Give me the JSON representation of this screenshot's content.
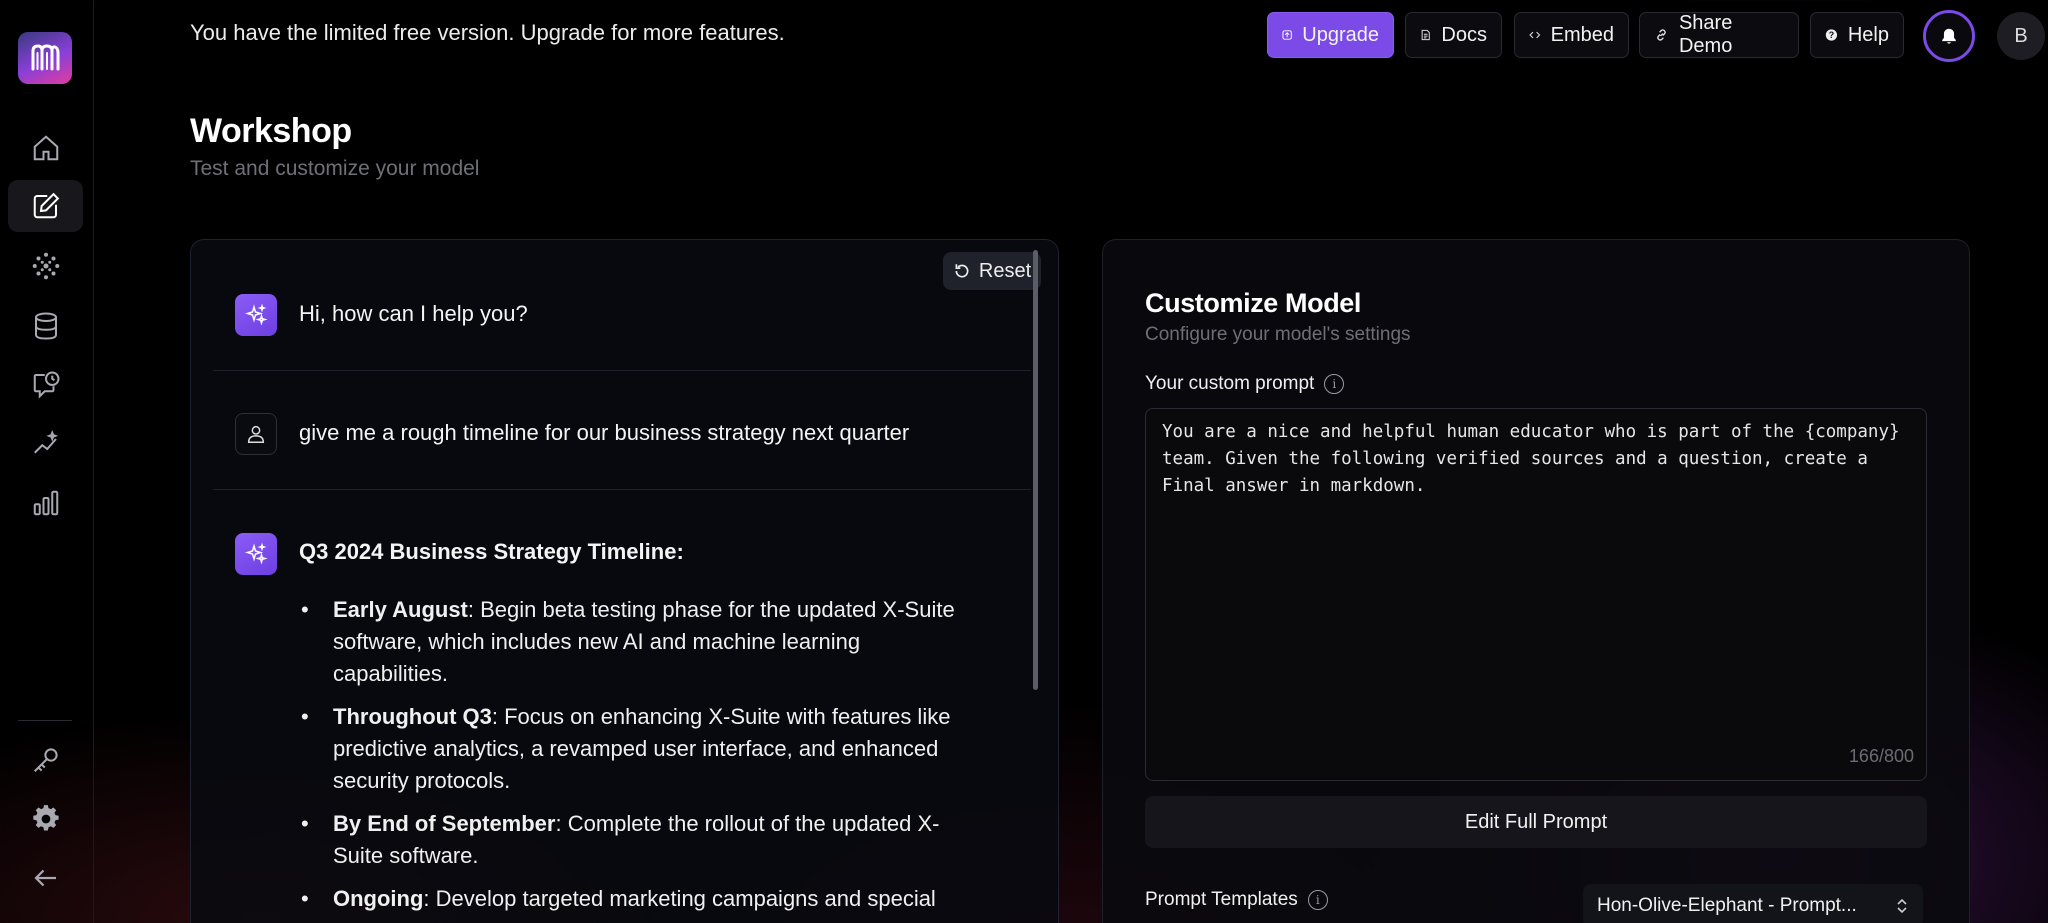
{
  "banner": "You have the limited free version. Upgrade for more features.",
  "topbar": {
    "upgrade": "Upgrade",
    "docs": "Docs",
    "embed": "Embed",
    "share_demo": "Share Demo",
    "help": "Help",
    "avatar_initial": "B"
  },
  "page": {
    "title": "Workshop",
    "subtitle": "Test and customize your model"
  },
  "chat": {
    "reset": "Reset",
    "messages": [
      {
        "role": "bot",
        "text": "Hi, how can I help you?"
      },
      {
        "role": "user",
        "text": "give me a rough timeline for our business strategy next quarter"
      }
    ],
    "answer": {
      "title": "Q3 2024 Business Strategy Timeline:",
      "items": [
        {
          "bold": "Early August",
          "text": ": Begin beta testing phase for the updated X-Suite software, which includes new AI and machine learning capabilities."
        },
        {
          "bold": "Throughout Q3",
          "text": ": Focus on enhancing X-Suite with features like predictive analytics, a revamped user interface, and enhanced security protocols."
        },
        {
          "bold": "By End of September",
          "text": ": Complete the rollout of the updated X-Suite software."
        },
        {
          "bold": "Ongoing",
          "text": ": Develop targeted marketing campaigns and special"
        }
      ]
    }
  },
  "customize": {
    "title": "Customize Model",
    "subtitle": "Configure your model's settings",
    "prompt_label": "Your custom prompt",
    "prompt_value": "You are a nice and helpful human educator who is part of the {company} team. Given the following verified sources and a question, create a Final answer in markdown.",
    "counter": "166/800",
    "edit_full_prompt": "Edit Full Prompt",
    "templates_label": "Prompt Templates",
    "template_selected": "Hon-Olive-Elephant - Prompt..."
  },
  "colors": {
    "accent": "#7c4ae6",
    "background": "#000000"
  }
}
